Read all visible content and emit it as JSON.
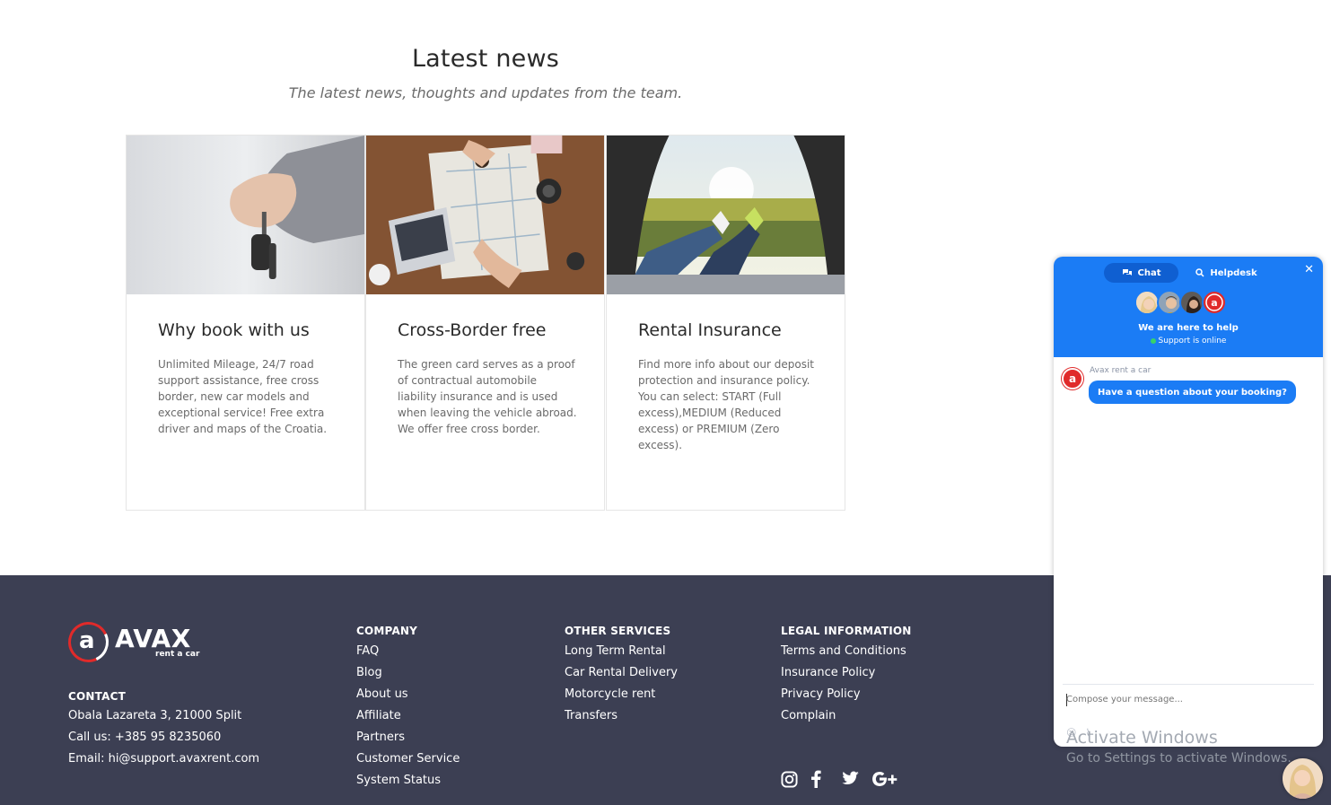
{
  "news": {
    "title": "Latest news",
    "subtitle": "The latest news, thoughts and updates from the team.",
    "cards": [
      {
        "title": "Why book with us",
        "text": "Unlimited Mileage, 24/7 road support assistance, free cross border, new car models and exceptional service! Free extra driver and maps of the Croatia."
      },
      {
        "title": "Cross-Border free",
        "text": "The green card serves as a proof of contractual automobile liability insurance and is used when leaving the vehicle abroad. We offer free cross border."
      },
      {
        "title": "Rental Insurance",
        "text": "Find more info about our deposit protection and insurance policy. You can select: START (Full excess),MEDIUM (Reduced excess) or PREMIUM (Zero excess)."
      }
    ]
  },
  "footer": {
    "logo": {
      "word": "AVAX",
      "letter": "a",
      "tagline": "rent a car"
    },
    "contact": {
      "heading": "CONTACT",
      "address": "Obala Lazareta 3, 21000 Split",
      "phone": "Call us: +385 95 8235060",
      "email": "Email: hi@support.avaxrent.com"
    },
    "company": {
      "heading": "COMPANY",
      "links": [
        "FAQ",
        "Blog",
        "About us",
        "Affiliate",
        "Partners",
        "Customer Service",
        "System Status"
      ]
    },
    "services": {
      "heading": "OTHER SERVICES",
      "links": [
        "Long Term Rental",
        "Car Rental Delivery",
        "Motorcycle rent",
        "Transfers"
      ]
    },
    "legal": {
      "heading": "LEGAL INFORMATION",
      "links": [
        "Terms and Conditions",
        "Insurance Policy",
        "Privacy Policy",
        "Complain"
      ]
    },
    "social_icons": [
      "instagram-icon",
      "facebook-icon",
      "twitter-icon",
      "google-plus-icon"
    ],
    "colors": {
      "background": "#3c3f53",
      "logo_accent": "#e02a2a"
    }
  },
  "chat": {
    "tabs": [
      {
        "label": "Chat",
        "icon": "chat-bubbles-icon",
        "active": true
      },
      {
        "label": "Helpdesk",
        "icon": "search-icon",
        "active": false
      }
    ],
    "close_icon": "close-icon",
    "help_title": "We are here to help",
    "status": "Support is online",
    "author": "Avax rent a car",
    "author_avatar_letter": "a",
    "message": "Have a question about your booking?",
    "compose_placeholder": "Compose your message...",
    "colors": {
      "header": "#1b7cf5",
      "online": "#38d26a"
    }
  },
  "watermark": {
    "line1": "Activate Windows",
    "line2": "Go to Settings to activate Windows."
  }
}
